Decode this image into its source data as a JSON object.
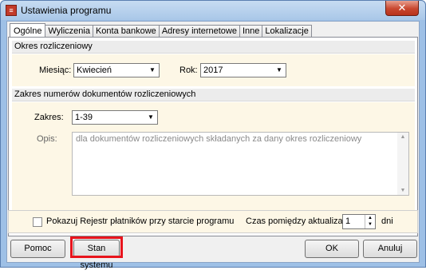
{
  "window": {
    "title": "Ustawienia programu",
    "close_glyph": "✕",
    "app_icon": "app-icon-red"
  },
  "tabs": [
    "Ogólne",
    "Wyliczenia",
    "Konta bankowe",
    "Adresy internetowe",
    "Inne",
    "Lokalizacje"
  ],
  "active_tab": "Ogólne",
  "period": {
    "header": "Okres rozliczeniowy",
    "month_label": "Miesiąc:",
    "month_value": "Kwiecień",
    "year_label": "Rok:",
    "year_value": "2017"
  },
  "ranges": {
    "header": "Zakres numerów dokumentów rozliczeniowych",
    "range_label": "Zakres:",
    "range_value": "1-39",
    "desc_label": "Opis:",
    "desc_value": "dla dokumentów rozliczeniowych składanych za dany okres rozliczeniowy"
  },
  "options": {
    "show_register_label": "Pokazuj Rejestr płatników przy starcie programu",
    "show_register_checked": false,
    "interval_label": "Czas pomiędzy aktualizacjami",
    "interval_value": "1",
    "interval_unit": "dni"
  },
  "buttons": {
    "help": "Pomoc",
    "system_status": "Stan systemu",
    "ok": "OK",
    "cancel": "Anuluj"
  },
  "colors": {
    "highlight": "#e8141c",
    "section_bg": "#fdf7e6"
  }
}
